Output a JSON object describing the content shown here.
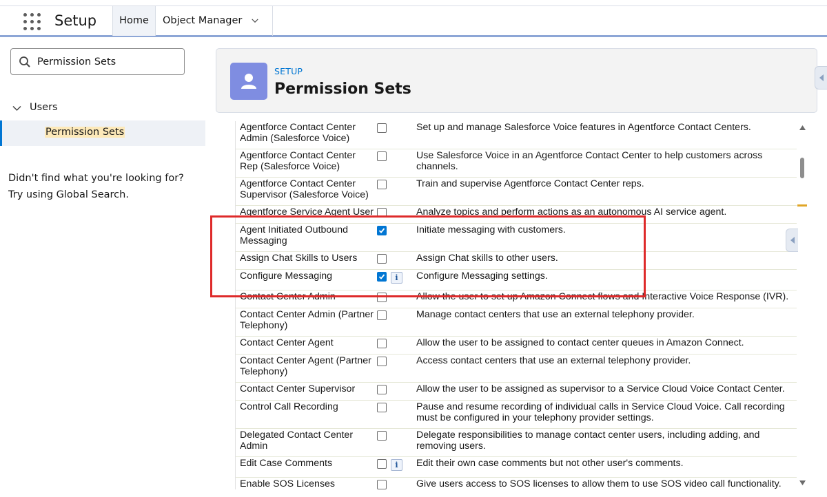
{
  "header": {
    "app_title": "Setup",
    "tabs": [
      {
        "label": "Home"
      },
      {
        "label": "Object Manager"
      }
    ]
  },
  "sidebar": {
    "search_value": "Permission Sets",
    "tree_parent": "Users",
    "tree_child": "Permission Sets",
    "help_text": "Didn't find what you're looking for? Try using Global Search."
  },
  "page_header": {
    "eyebrow": "SETUP",
    "title": "Permission Sets",
    "icon": "user-icon"
  },
  "permissions": [
    {
      "name": "Agentforce Contact Center Admin (Salesforce Voice)",
      "checked": false,
      "info": false,
      "description": "Set up and manage Salesforce Voice features in Agentforce Contact Centers."
    },
    {
      "name": "Agentforce Contact Center Rep (Salesforce Voice)",
      "checked": false,
      "info": false,
      "description": "Use Salesforce Voice in an Agentforce Contact Center to help customers across channels."
    },
    {
      "name": "Agentforce Contact Center Supervisor (Salesforce Voice)",
      "checked": false,
      "info": false,
      "description": "Train and supervise Agentforce Contact Center reps."
    },
    {
      "name": "Agentforce Service Agent User",
      "checked": false,
      "info": false,
      "description": "Analyze topics and perform actions as an autonomous AI service agent."
    },
    {
      "name": "Agent Initiated Outbound Messaging",
      "checked": true,
      "info": false,
      "description": "Initiate messaging with customers."
    },
    {
      "name": "Assign Chat Skills to Users",
      "checked": false,
      "info": false,
      "description": "Assign Chat skills to other users."
    },
    {
      "name": "Configure Messaging",
      "checked": true,
      "info": true,
      "description": "Configure Messaging settings."
    },
    {
      "name": "Contact Center Admin",
      "checked": false,
      "info": false,
      "description": "Allow the user to set up Amazon Connect flows and Interactive Voice Response (IVR)."
    },
    {
      "name": "Contact Center Admin (Partner Telephony)",
      "checked": false,
      "info": false,
      "description": "Manage contact centers that use an external telephony provider."
    },
    {
      "name": "Contact Center Agent",
      "checked": false,
      "info": false,
      "description": "Allow the user to be assigned to contact center queues in Amazon Connect."
    },
    {
      "name": "Contact Center Agent (Partner Telephony)",
      "checked": false,
      "info": false,
      "description": "Access contact centers that use an external telephony provider."
    },
    {
      "name": "Contact Center Supervisor",
      "checked": false,
      "info": false,
      "description": "Allow the user to be assigned as supervisor to a Service Cloud Voice Contact Center."
    },
    {
      "name": "Control Call Recording",
      "checked": false,
      "info": false,
      "description": "Pause and resume recording of individual calls in Service Cloud Voice. Call recording must be configured in your telephony provider settings."
    },
    {
      "name": "Delegated Contact Center Admin",
      "checked": false,
      "info": false,
      "description": "Delegate responsibilities to manage contact center users, including adding, and removing users."
    },
    {
      "name": "Edit Case Comments",
      "checked": false,
      "info": true,
      "description": "Edit their own case comments but not other user's comments."
    },
    {
      "name": "Enable SOS Licenses",
      "checked": false,
      "info": false,
      "description": "Give users access to SOS licenses to allow them to use SOS video call functionality."
    }
  ],
  "colors": {
    "accent": "#0176d3",
    "highlight_box": "#de2a2a",
    "header_icon_bg": "#7f8de1",
    "search_match": "#fde9b9"
  }
}
